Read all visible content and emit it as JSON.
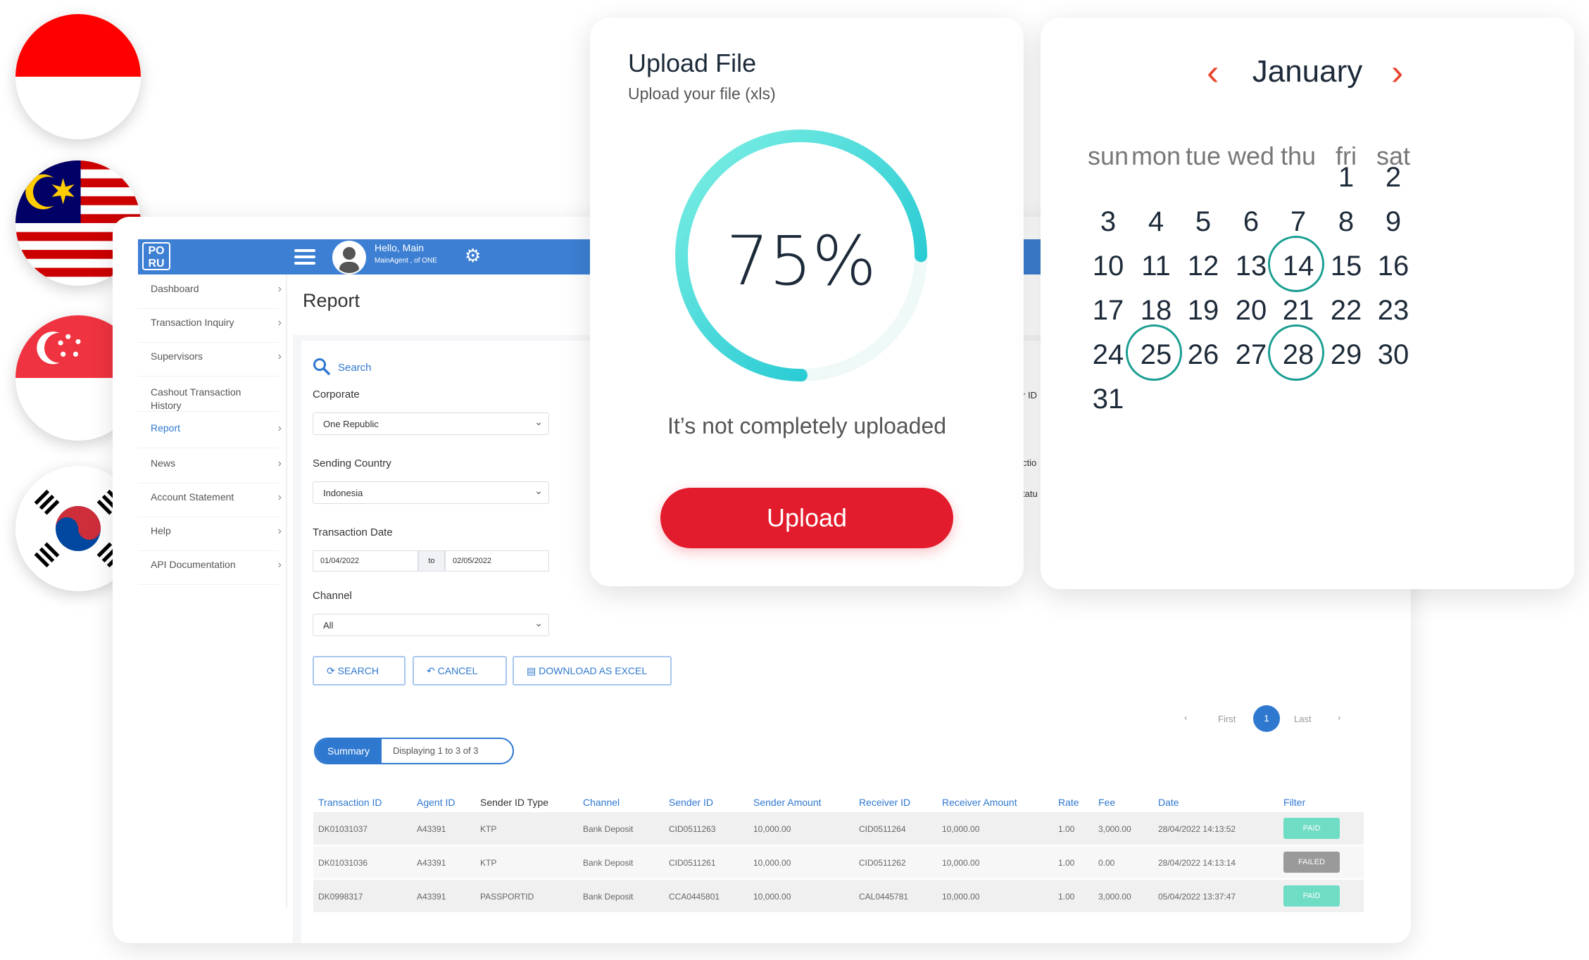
{
  "flags": [
    {
      "name": "indonesia-flag",
      "colors": [
        "#ff0000",
        "#ffffff"
      ]
    },
    {
      "name": "malaysia-flag",
      "colors": [
        "#cc0001",
        "#ffffff",
        "#010066",
        "#ffcc00"
      ]
    },
    {
      "name": "singapore-flag",
      "colors": [
        "#ef3340",
        "#ffffff"
      ]
    },
    {
      "name": "south-korea-flag",
      "colors": [
        "#ffffff",
        "#cd2e3a",
        "#0047a0",
        "#000000"
      ]
    }
  ],
  "dashboard": {
    "logo": "PO RU",
    "greeting": "Hello, Main",
    "agent": "MainAgent , of ONE",
    "page_title": "Report",
    "sidebar": [
      {
        "label": "Dashboard",
        "active": false
      },
      {
        "label": "Transaction Inquiry",
        "active": false
      },
      {
        "label": "Supervisors",
        "active": false
      },
      {
        "label": "Cashout Transaction History",
        "active": false
      },
      {
        "label": "Report",
        "active": true
      },
      {
        "label": "News",
        "active": false
      },
      {
        "label": "Account Statement",
        "active": false
      },
      {
        "label": "Help",
        "active": false
      },
      {
        "label": "API Documentation",
        "active": false
      }
    ],
    "search_label": "Search",
    "corporate_label": "Corporate",
    "corporate_value": "One Republic",
    "sending_country_label": "Sending Country",
    "sending_country_value": "Indonesia",
    "transaction_date_label": "Transaction Date",
    "date_from": "01/04/2022",
    "date_to_label": "to",
    "date_to": "02/05/2022",
    "channel_label": "Channel",
    "channel_value": "All",
    "buttons": {
      "search": "SEARCH",
      "cancel": "CANCEL",
      "download": "DOWNLOAD AS EXCEL"
    },
    "pagination": {
      "prev": "‹",
      "first": "First",
      "current": "1",
      "last": "Last",
      "next": "›"
    },
    "summary_tab": "Summary",
    "displaying": "Displaying 1 to 3 of 3",
    "peek_labels": [
      "r ID",
      "ctio",
      "tatu"
    ],
    "table": {
      "headers": [
        "Transaction ID",
        "Agent ID",
        "Sender ID Type",
        "Channel",
        "Sender ID",
        "Sender Amount",
        "Receiver ID",
        "Receiver Amount",
        "Rate",
        "Fee",
        "Date",
        "Filter"
      ],
      "rows": [
        {
          "transaction_id": "DK01031037",
          "agent_id": "A43391",
          "sender_id_type": "KTP",
          "channel": "Bank Deposit",
          "sender_id": "CID0511263",
          "sender_amount": "10,000.00",
          "receiver_id": "CID0511264",
          "receiver_amount": "10,000.00",
          "rate": "1.00",
          "fee": "3,000.00",
          "date": "28/04/2022 14:13:52",
          "status": "PAID"
        },
        {
          "transaction_id": "DK01031036",
          "agent_id": "A43391",
          "sender_id_type": "KTP",
          "channel": "Bank Deposit",
          "sender_id": "CID0511261",
          "sender_amount": "10,000.00",
          "receiver_id": "CID0511262",
          "receiver_amount": "10,000.00",
          "rate": "1.00",
          "fee": "0.00",
          "date": "28/04/2022 14:13:14",
          "status": "FAILED"
        },
        {
          "transaction_id": "DK0998317",
          "agent_id": "A43391",
          "sender_id_type": "PASSPORTID",
          "channel": "Bank Deposit",
          "sender_id": "CCA0445801",
          "sender_amount": "10,000.00",
          "receiver_id": "CAL0445781",
          "receiver_amount": "10,000.00",
          "rate": "1.00",
          "fee": "3,000.00",
          "date": "05/04/2022 13:37:47",
          "status": "PAID"
        }
      ]
    },
    "colors": {
      "primary": "#3d7fd3",
      "paid": "#6fdcc4",
      "failed": "#9a9a9a"
    }
  },
  "upload": {
    "title": "Upload File",
    "subtitle": "Upload your file (xls)",
    "progress": 0.75,
    "progress_label": "75%",
    "message": "It’s not completely uploaded",
    "button": "Upload",
    "colors": {
      "button": "#e21c2c",
      "ring_start": "#11c0cf",
      "ring_end": "#7ff0e4"
    }
  },
  "calendar": {
    "month": "January",
    "weekdays": [
      "sun",
      "mon",
      "tue",
      "wed",
      "thu",
      "fri",
      "sat"
    ],
    "first_weekday_index": 5,
    "days_in_month": 31,
    "highlighted_days": [
      14,
      25,
      28
    ],
    "colors": {
      "arrows": "#e8472f",
      "highlight": "#1a9e92"
    }
  }
}
